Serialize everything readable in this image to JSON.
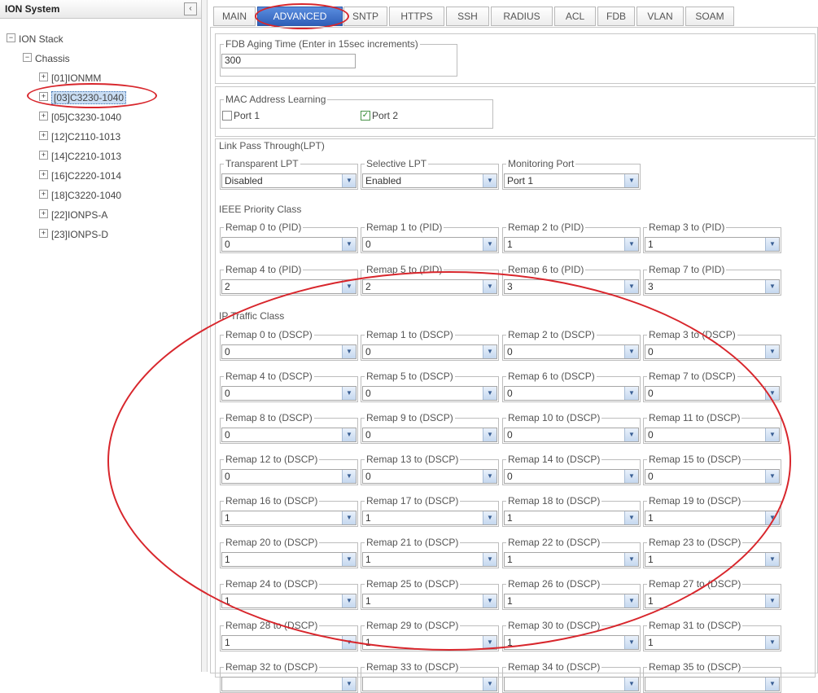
{
  "left_panel": {
    "title": "ION System",
    "collapse_icon": "‹",
    "tree": [
      {
        "label": "ION Stack",
        "toggle": "−"
      },
      {
        "label": "Chassis",
        "toggle": "−"
      },
      {
        "label": "[01]IONMM",
        "toggle": "+"
      },
      {
        "label": "[03]C3230-1040",
        "toggle": "+"
      },
      {
        "label": "[05]C3230-1040",
        "toggle": "+"
      },
      {
        "label": "[12]C2110-1013",
        "toggle": "+"
      },
      {
        "label": "[14]C2210-1013",
        "toggle": "+"
      },
      {
        "label": "[16]C2220-1014",
        "toggle": "+"
      },
      {
        "label": "[18]C3220-1040",
        "toggle": "+"
      },
      {
        "label": "[22]IONPS-A",
        "toggle": "+"
      },
      {
        "label": "[23]IONPS-D",
        "toggle": "+"
      }
    ]
  },
  "tabs": [
    "MAIN",
    "ADVANCED",
    "SNTP",
    "HTTPS",
    "SSH",
    "RADIUS",
    "ACL",
    "FDB",
    "VLAN",
    "SOAM"
  ],
  "active_tab": "ADVANCED",
  "fdb": {
    "legend": "FDB Aging Time (Enter in 15sec increments)",
    "value": "300"
  },
  "mac_learning": {
    "legend": "MAC Address Learning",
    "port1": "Port 1",
    "port2": "Port 2",
    "port1_checked": false,
    "port2_checked": true,
    "check_glyph": "✓"
  },
  "lpt": {
    "title": "Link Pass Through(LPT)",
    "transparent": {
      "legend": "Transparent LPT",
      "value": "Disabled"
    },
    "selective": {
      "legend": "Selective LPT",
      "value": "Enabled"
    },
    "monitoring": {
      "legend": "Monitoring Port",
      "value": "Port 1"
    }
  },
  "ieee": {
    "title": "IEEE Priority Class",
    "remaps": [
      {
        "legend": "Remap 0 to (PID)",
        "value": "0"
      },
      {
        "legend": "Remap 1 to (PID)",
        "value": "0"
      },
      {
        "legend": "Remap 2 to (PID)",
        "value": "1"
      },
      {
        "legend": "Remap 3 to (PID)",
        "value": "1"
      },
      {
        "legend": "Remap 4 to (PID)",
        "value": "2"
      },
      {
        "legend": "Remap 5 to (PID)",
        "value": "2"
      },
      {
        "legend": "Remap 6 to (PID)",
        "value": "3"
      },
      {
        "legend": "Remap 7 to (PID)",
        "value": "3"
      }
    ]
  },
  "ip": {
    "title": "IP Traffic Class",
    "remaps": [
      {
        "legend": "Remap 0 to (DSCP)",
        "value": "0"
      },
      {
        "legend": "Remap 1 to (DSCP)",
        "value": "0"
      },
      {
        "legend": "Remap 2 to (DSCP)",
        "value": "0"
      },
      {
        "legend": "Remap 3 to (DSCP)",
        "value": "0"
      },
      {
        "legend": "Remap 4 to (DSCP)",
        "value": "0"
      },
      {
        "legend": "Remap 5 to (DSCP)",
        "value": "0"
      },
      {
        "legend": "Remap 6 to (DSCP)",
        "value": "0"
      },
      {
        "legend": "Remap 7 to (DSCP)",
        "value": "0"
      },
      {
        "legend": "Remap 8 to (DSCP)",
        "value": "0"
      },
      {
        "legend": "Remap 9 to (DSCP)",
        "value": "0"
      },
      {
        "legend": "Remap 10 to (DSCP)",
        "value": "0"
      },
      {
        "legend": "Remap 11 to (DSCP)",
        "value": "0"
      },
      {
        "legend": "Remap 12 to (DSCP)",
        "value": "0"
      },
      {
        "legend": "Remap 13 to (DSCP)",
        "value": "0"
      },
      {
        "legend": "Remap 14 to (DSCP)",
        "value": "0"
      },
      {
        "legend": "Remap 15 to (DSCP)",
        "value": "0"
      },
      {
        "legend": "Remap 16 to (DSCP)",
        "value": "1"
      },
      {
        "legend": "Remap 17 to (DSCP)",
        "value": "1"
      },
      {
        "legend": "Remap 18 to (DSCP)",
        "value": "1"
      },
      {
        "legend": "Remap 19 to (DSCP)",
        "value": "1"
      },
      {
        "legend": "Remap 20 to (DSCP)",
        "value": "1"
      },
      {
        "legend": "Remap 21 to (DSCP)",
        "value": "1"
      },
      {
        "legend": "Remap 22 to (DSCP)",
        "value": "1"
      },
      {
        "legend": "Remap 23 to (DSCP)",
        "value": "1"
      },
      {
        "legend": "Remap 24 to (DSCP)",
        "value": "1"
      },
      {
        "legend": "Remap 25 to (DSCP)",
        "value": "1"
      },
      {
        "legend": "Remap 26 to (DSCP)",
        "value": "1"
      },
      {
        "legend": "Remap 27 to (DSCP)",
        "value": "1"
      },
      {
        "legend": "Remap 28 to (DSCP)",
        "value": "1"
      },
      {
        "legend": "Remap 29 to (DSCP)",
        "value": "1"
      },
      {
        "legend": "Remap 30 to (DSCP)",
        "value": "1"
      },
      {
        "legend": "Remap 31 to (DSCP)",
        "value": "1"
      },
      {
        "legend": "Remap 32 to (DSCP)",
        "value": ""
      },
      {
        "legend": "Remap 33 to (DSCP)",
        "value": ""
      },
      {
        "legend": "Remap 34 to (DSCP)",
        "value": ""
      },
      {
        "legend": "Remap 35 to (DSCP)",
        "value": ""
      }
    ]
  },
  "colors": {
    "annotation": "#d8262c",
    "tab_active": "#3a6cc7",
    "selection": "#c9ddf3"
  },
  "icons": {
    "dropdown": "▼",
    "expand": "+",
    "collapse": "−"
  }
}
